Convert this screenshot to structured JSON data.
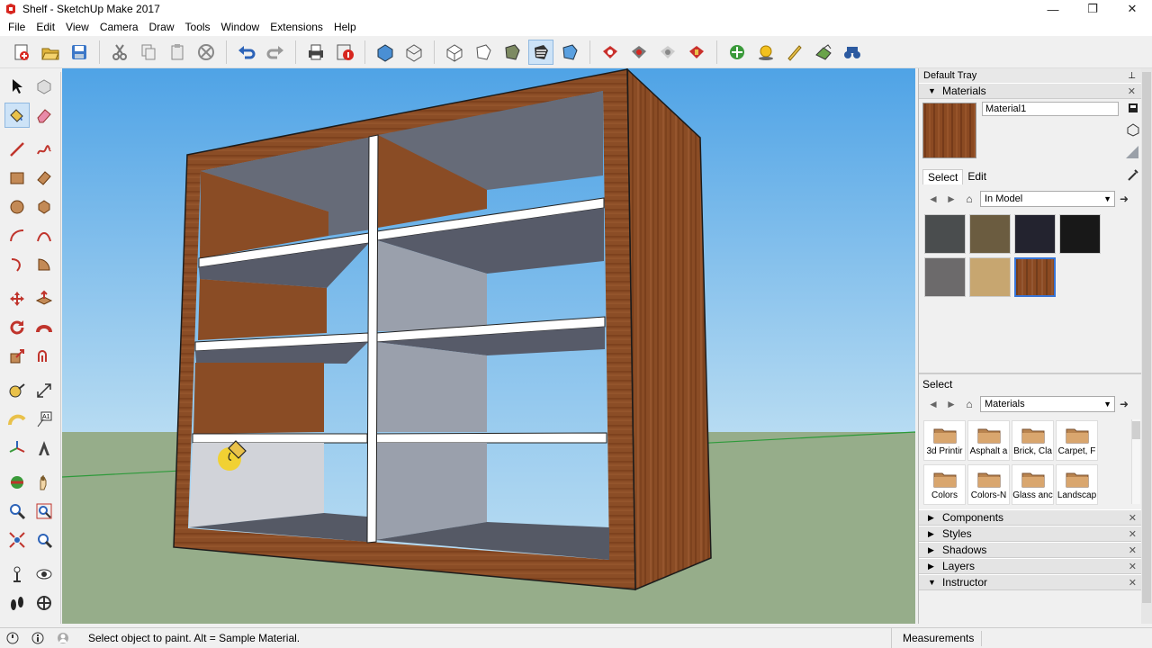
{
  "window": {
    "title": "Shelf - SketchUp Make 2017",
    "controls": [
      "—",
      "❐",
      "✕"
    ]
  },
  "menu": [
    "File",
    "Edit",
    "View",
    "Camera",
    "Draw",
    "Tools",
    "Window",
    "Extensions",
    "Help"
  ],
  "toolbar": {
    "icons": [
      "new-file",
      "open-file",
      "save",
      "cut",
      "copy",
      "paste",
      "erase",
      "undo",
      "redo",
      "print",
      "model-info",
      "iso-view",
      "top-view",
      "front-view",
      "right-view",
      "back-view",
      "left-view",
      "wireframe",
      "hidden-line",
      "shaded",
      "shaded-textures",
      "monochrome",
      "3d-warehouse",
      "share-model",
      "get-models",
      "extension-warehouse",
      "layout",
      "geo-location",
      "shadows",
      "sandbox",
      "section",
      "binoculars"
    ]
  },
  "left_tools": [
    "select",
    "make-component",
    "paint-bucket",
    "eraser",
    "line",
    "freehand",
    "rectangle",
    "rotated-rectangle",
    "circle",
    "polygon",
    "arc",
    "two-point-arc",
    "three-point-arc",
    "pie",
    "move",
    "push-pull",
    "rotate",
    "follow-me",
    "scale",
    "offset",
    "tape-measure",
    "dimension",
    "protractor",
    "text",
    "axes",
    "3d-text",
    "orbit",
    "pan",
    "zoom",
    "zoom-window",
    "zoom-extents",
    "previous-view",
    "position-camera",
    "look-around",
    "walk",
    "section-plane"
  ],
  "tray": {
    "title": "Default Tray",
    "materials_panel": {
      "header": "Materials",
      "material_name": "Material1",
      "tabs": [
        "Select",
        "Edit"
      ],
      "collection": "In Model",
      "swatch_colors": [
        "#4a4d4e",
        "#6b5c40",
        "#23232f",
        "#181818",
        "#6c6a6b",
        "#c7a670",
        "#8b4a22"
      ],
      "selected_swatch": 6
    },
    "select_section": {
      "label": "Select",
      "collection": "Materials",
      "library": [
        "3d Printir",
        "Asphalt a",
        "Brick, Cla",
        "Carpet, F",
        "Colors",
        "Colors-N",
        "Glass anc",
        "Landscap"
      ]
    },
    "collapsed_panels": [
      "Components",
      "Styles",
      "Shadows",
      "Layers"
    ],
    "expanded_panel": "Instructor"
  },
  "status": {
    "message": "Select object to paint. Alt = Sample Material.",
    "measurements_label": "Measurements"
  },
  "colors": {
    "sky_top": "#52a6e8",
    "sky_bottom": "#b2d7ef",
    "ground": "#96ad8a",
    "wood": "#8b4d26",
    "interior_gray": "#6b6e7a",
    "shelf_white": "#ffffff",
    "selection_blue": "#3875d7"
  }
}
